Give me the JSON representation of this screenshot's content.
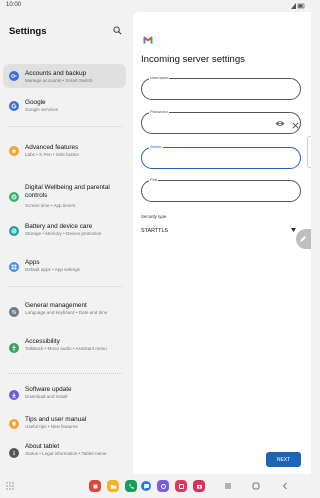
{
  "status_bar": {
    "time": "10:00",
    "icons": "signal-battery-icon"
  },
  "settings": {
    "title": "Settings",
    "search_icon": "search-icon",
    "items": [
      {
        "title": "Accounts and backup",
        "subtitle": "Manage accounts • Smart Switch",
        "icon": "key-icon",
        "color": "#3d6ee0",
        "selected": true
      },
      {
        "title": "Google",
        "subtitle": "Google services",
        "icon": "google-g-icon",
        "color": "#3d6ee0"
      },
      {
        "title": "Advanced features",
        "subtitle": "Labs • S Pen • Side button",
        "icon": "star-plus-icon",
        "color": "#f2a531"
      },
      {
        "title": "Digital Wellbeing and parental controls",
        "subtitle": "Screen time • App timers",
        "icon": "wellbeing-icon",
        "color": "#36b46a"
      },
      {
        "title": "Battery and device care",
        "subtitle": "Storage • Memory • Device protection",
        "icon": "device-care-icon",
        "color": "#1ea5a5"
      },
      {
        "title": "Apps",
        "subtitle": "Default apps • App settings",
        "icon": "apps-grid-icon",
        "color": "#4a8ae8"
      },
      {
        "title": "General management",
        "subtitle": "Language and keyboard • Date and time",
        "icon": "sliders-icon",
        "color": "#6b7b8c"
      },
      {
        "title": "Accessibility",
        "subtitle": "TalkBack • Mono audio • Assistant menu",
        "icon": "accessibility-icon",
        "color": "#3aa35a"
      },
      {
        "title": "Software update",
        "subtitle": "Download and install",
        "icon": "software-update-icon",
        "color": "#6a5bd6"
      },
      {
        "title": "Tips and user manual",
        "subtitle": "Useful tips • New features",
        "icon": "lightbulb-icon",
        "color": "#f2a531"
      },
      {
        "title": "About tablet",
        "subtitle": "Status • Legal information • Tablet name",
        "icon": "info-icon",
        "color": "#555555"
      }
    ]
  },
  "incoming": {
    "app_icon": "gmail-icon",
    "title": "Incoming server settings",
    "fields": [
      {
        "label": "Username",
        "value": ""
      },
      {
        "label": "Password",
        "value": "",
        "trailing_icon": "eye-icon"
      },
      {
        "label": "Server",
        "value": "",
        "focused": true
      },
      {
        "label": "Port",
        "value": ""
      }
    ],
    "clear_icon": "close-icon",
    "security_label": "Security type",
    "security_value": "STARTTLS",
    "next_label": "NEXT",
    "accent": "#1e63b4"
  },
  "nav_bar": {
    "apps": [
      {
        "name": "app-red",
        "color": "#e0453a"
      },
      {
        "name": "app-yellow",
        "color": "#f4b324"
      },
      {
        "name": "app-phone",
        "color": "#13a05c"
      },
      {
        "name": "app-messages",
        "color": "#1e7be6"
      },
      {
        "name": "app-purple",
        "color": "#7b5ce6"
      },
      {
        "name": "app-pink",
        "color": "#e2365e"
      },
      {
        "name": "app-camera",
        "color": "#d9325a"
      }
    ]
  }
}
